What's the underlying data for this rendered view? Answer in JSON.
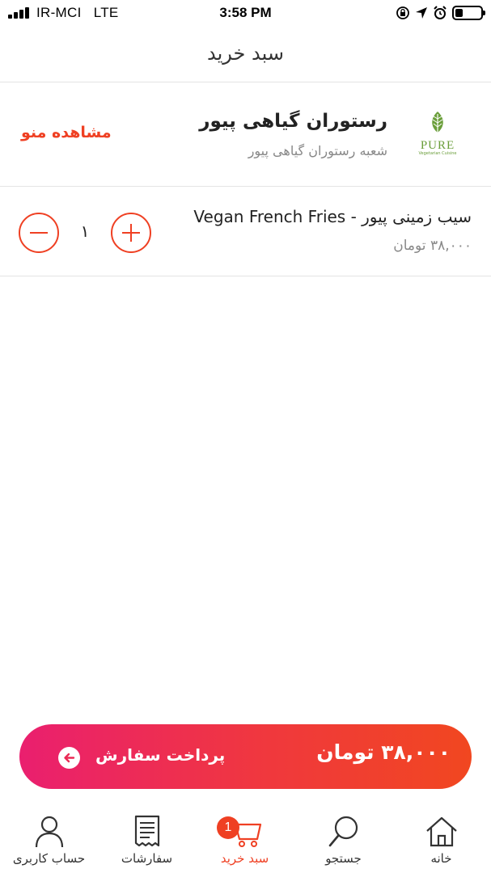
{
  "status_bar": {
    "carrier": "IR-MCI",
    "network": "LTE",
    "time": "3:58 PM",
    "battery_level": 0.3
  },
  "header": {
    "title": "سبد خرید"
  },
  "restaurant": {
    "name": "رستوران گیاهی پیور",
    "branch": "شعبه رستوران گیاهی پیور",
    "view_menu_label": "مشاهده منو",
    "logo_text": "PURE",
    "logo_subtext": "Vegetarian Cuisine"
  },
  "cart_items": [
    {
      "name": "سیب زمینی پیور - Vegan French Fries",
      "price": "۳۸,۰۰۰ تومان",
      "quantity": "۱"
    }
  ],
  "checkout": {
    "total": "۳۸,۰۰۰ تومان",
    "label": "پرداخت سفارش"
  },
  "tabbar": {
    "items": [
      {
        "label": "حساب کاربری",
        "icon": "user-icon",
        "active": false
      },
      {
        "label": "سفارشات",
        "icon": "receipt-icon",
        "active": false
      },
      {
        "label": "سبد خرید",
        "icon": "cart-icon",
        "active": true,
        "badge": "1"
      },
      {
        "label": "جستجو",
        "icon": "search-icon",
        "active": false
      },
      {
        "label": "خانه",
        "icon": "home-icon",
        "active": false
      }
    ]
  },
  "colors": {
    "accent": "#ef4023",
    "gradient_start": "#ea1f6f",
    "gradient_end": "#f14720",
    "logo_green": "#6a9e3a"
  }
}
